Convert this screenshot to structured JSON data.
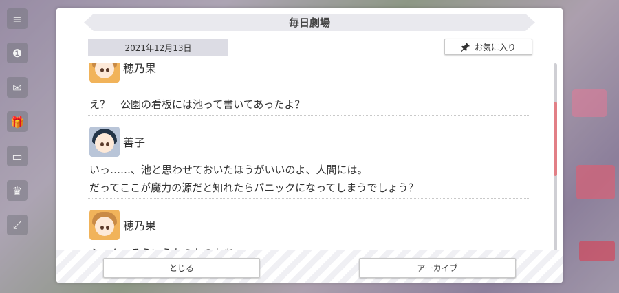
{
  "dialog": {
    "title": "毎日劇場",
    "date": "2021年12月13日",
    "favorite_label": "お気に入り",
    "close_label": "とじる",
    "archive_label": "アーカイブ"
  },
  "entries": [
    {
      "speaker": "穂乃果",
      "avatar": "honoka-avatar",
      "lines": [
        "え？　公園の看板には池って書いてあったよ？"
      ]
    },
    {
      "speaker": "善子",
      "avatar": "yoshiko-avatar",
      "lines": [
        "いっ……、池と思わせておいたほうがいいのよ、人間には。",
        "だってここが魔力の源だと知れたらパニックになってしまうでしょう？"
      ]
    },
    {
      "speaker": "穂乃果",
      "avatar": "honoka-avatar",
      "lines": [
        "ふーん、そういうものなのかあ"
      ]
    }
  ],
  "icons": {
    "favorite": "pin-icon",
    "menu": "menu-icon",
    "chat": "chat-icon",
    "gift": "gift-icon",
    "fullscreen": "fullscreen-icon"
  },
  "colors": {
    "scroll_thumb": "#e27f86",
    "title_bar": "#e9e9ee",
    "date_box": "#dcdce4"
  }
}
